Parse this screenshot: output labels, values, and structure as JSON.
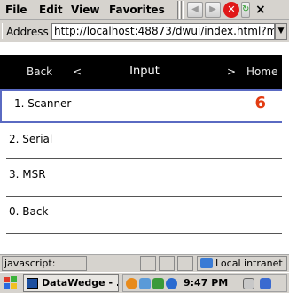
{
  "menubar": {
    "items": [
      "File",
      "Edit",
      "View",
      "Favorites"
    ],
    "close_label": "×"
  },
  "addressbar": {
    "label": "Address",
    "url": "http://localhost:48873/dwui/index.html?m"
  },
  "header": {
    "back_label": "Back",
    "back_arrow": "<",
    "title": "Input",
    "forward_arrow": ">",
    "home_label": "Home"
  },
  "menu_items": [
    {
      "label": "1. Scanner",
      "badge": "6"
    },
    {
      "label": "2. Serial"
    },
    {
      "label": "3. MSR"
    },
    {
      "label": "0. Back"
    }
  ],
  "statusbar": {
    "text": "javascript:",
    "zone": "Local intranet"
  },
  "taskbar": {
    "task_label": "DataWedge - ...",
    "clock": "9:47 PM"
  },
  "colors": {
    "header_bg": "#000000",
    "selection_border": "#5a6ac2",
    "badge": "#e23c12",
    "chrome": "#d6d3ce"
  }
}
